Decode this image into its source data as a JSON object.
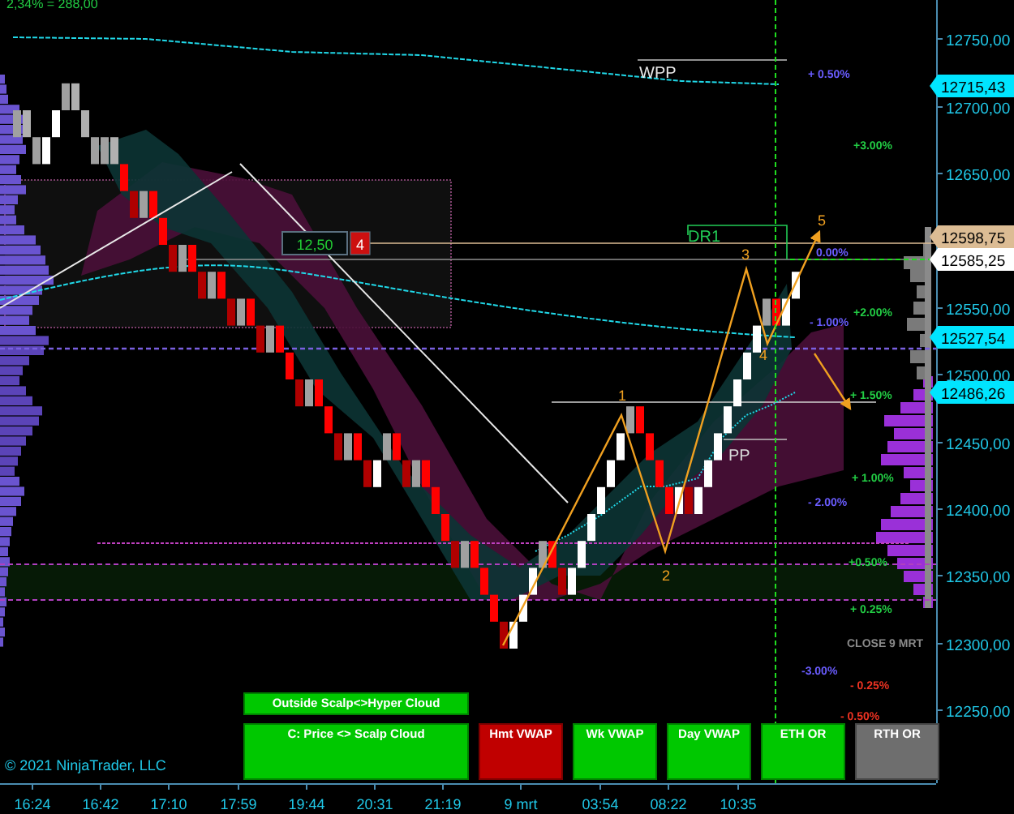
{
  "header_text": "2,34% = 288,00",
  "y_axis": {
    "ticks": [
      "12750,00",
      "12700,00",
      "12650,00",
      "12550,00",
      "12500,00",
      "12450,00",
      "12400,00",
      "12350,00",
      "12300,00",
      "12250,00"
    ]
  },
  "price_tags": [
    {
      "text": "12715,43",
      "color": "#00e5ff"
    },
    {
      "text": "12598,75",
      "color": "#dcbc94"
    },
    {
      "text": "12585,25",
      "color": "#ffffff"
    },
    {
      "text": "12527,54",
      "color": "#00e5ff"
    },
    {
      "text": "12486,26",
      "color": "#00e5ff"
    }
  ],
  "x_axis": {
    "labels": [
      "16:24",
      "16:42",
      "17:10",
      "17:59",
      "19:44",
      "20:31",
      "21:19",
      "9 mrt",
      "03:54",
      "08:22",
      "10:35"
    ]
  },
  "chart_labels": [
    {
      "text": "WPP",
      "color": "#e8e8e8"
    },
    {
      "text": "DR1",
      "color": "#22cc55"
    },
    {
      "text": "PP",
      "color": "#d8d8d8"
    },
    {
      "text": "1",
      "color": "#f0a020"
    },
    {
      "text": "2",
      "color": "#f0a020"
    },
    {
      "text": "3",
      "color": "#f0a020"
    },
    {
      "text": "4",
      "color": "#f0a020"
    },
    {
      "text": "5",
      "color": "#f0a020"
    }
  ],
  "percent_labels": [
    {
      "text": "+ 0.50%",
      "color": "#6a5cff"
    },
    {
      "text": "+3.00%",
      "color": "#22cc44"
    },
    {
      "text": "0.00%",
      "color": "#6a5cff"
    },
    {
      "text": "+2.00%",
      "color": "#22cc44"
    },
    {
      "text": "- 1.00%",
      "color": "#6a5cff"
    },
    {
      "text": "+ 1.50%",
      "color": "#22cc44"
    },
    {
      "text": "+ 1.00%",
      "color": "#22cc44"
    },
    {
      "text": "- 2.00%",
      "color": "#6a5cff"
    },
    {
      "text": "+0.50%",
      "color": "#22cc44"
    },
    {
      "text": "+ 0.25%",
      "color": "#22cc44"
    },
    {
      "text": "CLOSE 9 MRT",
      "color": "#8a8a8a"
    },
    {
      "text": "-3.00%",
      "color": "#6a5cff"
    },
    {
      "text": "- 0.25%",
      "color": "#ee3322"
    },
    {
      "text": "- 0.50%",
      "color": "#ee3322"
    }
  ],
  "order_box": {
    "value": "12,50",
    "count": "4"
  },
  "signals": [
    {
      "label": "Outside Scalp<>Hyper Cloud",
      "color": "#00c800"
    },
    {
      "label": "C: Price <> Scalp Cloud",
      "color": "#00c800"
    },
    {
      "label": "Hmt VWAP",
      "color": "#c00000"
    },
    {
      "label": "Wk VWAP",
      "color": "#00c800"
    },
    {
      "label": "Day VWAP",
      "color": "#00c800"
    },
    {
      "label": "ETH OR",
      "color": "#00c800"
    },
    {
      "label": "RTH OR",
      "color": "#6e6e6e"
    }
  ],
  "copyright": "© 2021 NinjaTrader, LLC"
}
